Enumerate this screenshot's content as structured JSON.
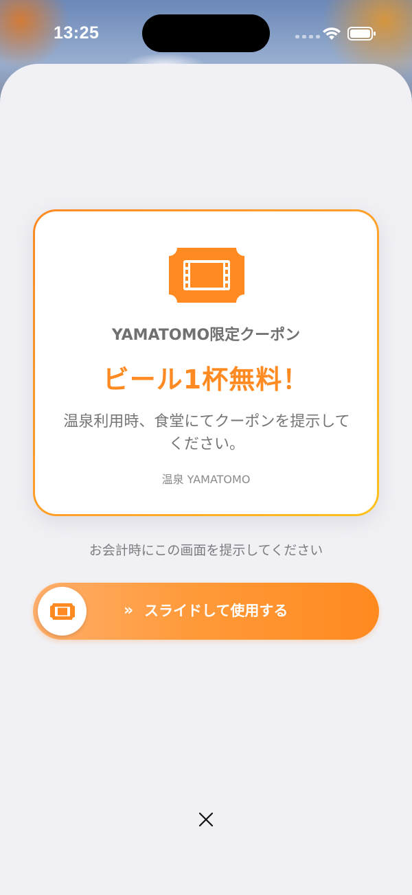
{
  "status_bar": {
    "time": "13:25"
  },
  "coupon": {
    "icon": "ticket-icon",
    "subtitle": "YAMATOMO限定クーポン",
    "title": "ビール1杯無料！",
    "description": "温泉利用時、食堂にてクーポンを提示してください。",
    "store": "温泉 YAMATOMO"
  },
  "instruction": "お会計時にこの画面を提示してください",
  "slide_button": {
    "chevrons": "»",
    "label": "スライドして使用する"
  },
  "close": {
    "icon": "close-icon"
  },
  "colors": {
    "accent": "#ff8a22",
    "accent_light": "#ffc21a",
    "sheet_background": "#f1f1f5"
  }
}
